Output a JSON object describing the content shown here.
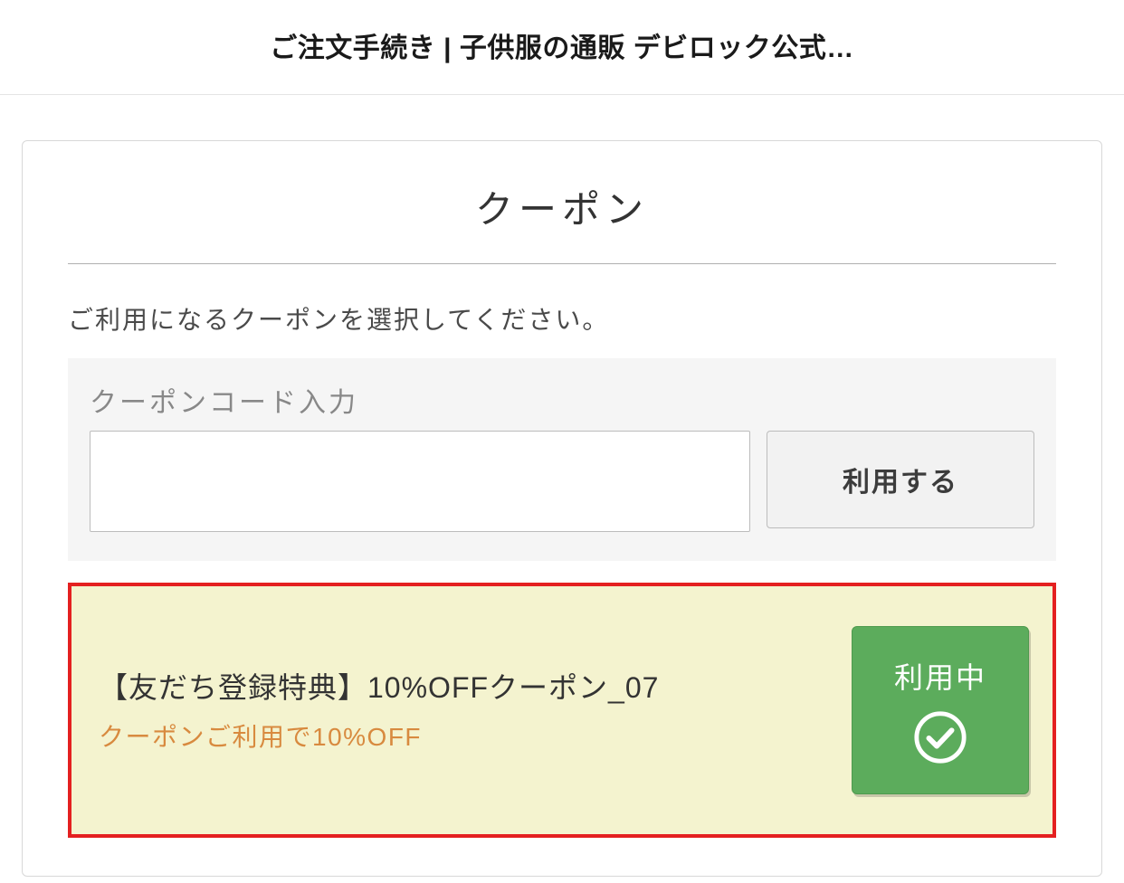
{
  "header": {
    "title": "ご注文手続き | 子供服の通販 デビロック公式…"
  },
  "panel": {
    "title": "クーポン",
    "instruction": "ご利用になるクーポンを選択してください。"
  },
  "code_entry": {
    "label": "クーポンコード入力",
    "input_value": "",
    "apply_label": "利用する"
  },
  "coupon": {
    "title": "【友だち登録特典】10%OFFクーポン_07",
    "description": "クーポンご利用で10%OFF",
    "status_label": "利用中"
  },
  "colors": {
    "highlight_border": "#e42020",
    "highlight_bg": "#f4f3cf",
    "status_bg": "#5cac5c",
    "desc_color": "#d88a3f"
  }
}
